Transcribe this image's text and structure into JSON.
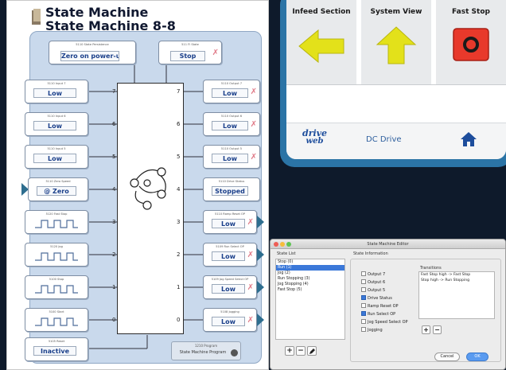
{
  "colors": {
    "accent_blue": "#1a3f8a",
    "panel_blue": "#c9d9ec",
    "app_frame": "#2b74a6",
    "stop_red": "#e8392b",
    "arrow_yellow": "#e3e11a"
  },
  "diagram": {
    "title_line1": "State Machine",
    "title_line2": "State Machine 8-8",
    "core_icon": "state-graph-icon",
    "pins_left": [
      "7",
      "6",
      "5",
      "4",
      "3",
      "2",
      "1",
      "0"
    ],
    "pins_right": [
      "7",
      "6",
      "5",
      "4",
      "3",
      "2",
      "1",
      "0"
    ],
    "top_blocks": [
      {
        "label": "5110 State Persistence",
        "value": "Zero on power-up"
      },
      {
        "label": "511 Fl State",
        "value": "Stop"
      }
    ],
    "inputs": [
      {
        "label": "5110 Input 7",
        "value": "Low"
      },
      {
        "label": "5110 Input 6",
        "value": "Low"
      },
      {
        "label": "5110 Input 5",
        "value": "Low"
      },
      {
        "label": "5110 Zero Speed",
        "value": "@ Zero"
      },
      {
        "label": "5120 Fast Stop",
        "value": ""
      },
      {
        "label": "5120 Jog",
        "value": ""
      },
      {
        "label": "5100 Stop",
        "value": ""
      },
      {
        "label": "5100 Start",
        "value": ""
      }
    ],
    "outputs": [
      {
        "label": "5110 Output 7",
        "value": "Low"
      },
      {
        "label": "5110 Output 6",
        "value": "Low"
      },
      {
        "label": "5110 Output 5",
        "value": "Low"
      },
      {
        "label": "5110 Drive Status",
        "value": "Stopped"
      },
      {
        "label": "5110 Ramp Reset OP",
        "value": "Low"
      },
      {
        "label": "5109 Run Select OP",
        "value": "Low"
      },
      {
        "label": "5109 Jog Speed Select OP",
        "value": "Low"
      },
      {
        "label": "5108 Jogging",
        "value": "Low"
      }
    ],
    "reset": {
      "label": "5105 Reset",
      "value": "Inactive"
    },
    "program": {
      "label": "1210 Program",
      "value": "State Machine Program"
    }
  },
  "app": {
    "tiles": [
      {
        "caption": "Infeed Section",
        "icon": "arrow-left-icon"
      },
      {
        "caption": "System View",
        "icon": "arrow-up-icon"
      },
      {
        "caption": "Fast Stop",
        "icon": "stop-icon"
      }
    ],
    "logo_line1": "drive",
    "logo_line2": "web",
    "tab_title": "DC Drive",
    "home_icon": "home-icon"
  },
  "editor": {
    "title": "State Machine Editor",
    "state_list_label": "State List",
    "states": [
      "Stop (0)",
      "Run (1)",
      "Jog (2)",
      "Run Stopping (3)",
      "Jog Stopping (4)",
      "Fast Stop (5)"
    ],
    "selected_state": 1,
    "info_label": "State Information",
    "outputs": [
      {
        "name": "Output 7",
        "checked": false
      },
      {
        "name": "Output 6",
        "checked": false
      },
      {
        "name": "Output 5",
        "checked": false
      },
      {
        "name": "Drive Status",
        "checked": true
      },
      {
        "name": "Ramp Reset OP",
        "checked": false
      },
      {
        "name": "Run Select OP",
        "checked": true
      },
      {
        "name": "Jog Speed Select OP",
        "checked": false
      },
      {
        "name": "Jogging",
        "checked": false
      }
    ],
    "transitions_label": "Transitions",
    "transitions": [
      "Fast Stop high -> Fast Stop",
      "Stop high -> Run Stopping"
    ],
    "cancel_label": "Cancel",
    "ok_label": "OK"
  }
}
